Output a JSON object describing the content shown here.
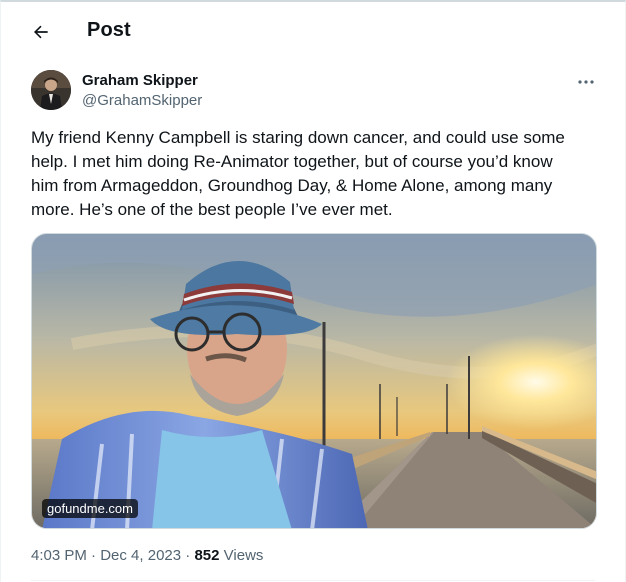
{
  "header": {
    "title": "Post"
  },
  "author": {
    "name": "Graham Skipper",
    "handle": "@GrahamSkipper"
  },
  "post": {
    "text": "My friend Kenny Campbell is staring down cancer, and could use some\nhelp. I met him doing Re-Animator together, but of course you’d know\nhim from Armageddon, Groundhog Day, & Home Alone, among many\nmore. He’s one of the best people I’ve ever met.",
    "media_source": "gofundme.com",
    "time": "4:03 PM",
    "separator": "·",
    "date": "Dec 4, 2023",
    "views_count": "852",
    "views_label": "Views"
  },
  "icons": {
    "back": "arrow-left-icon",
    "more": "ellipsis-horizontal-icon"
  },
  "colors": {
    "text_primary": "#0f1419",
    "text_secondary": "#536471",
    "border": "#cfd9de"
  }
}
